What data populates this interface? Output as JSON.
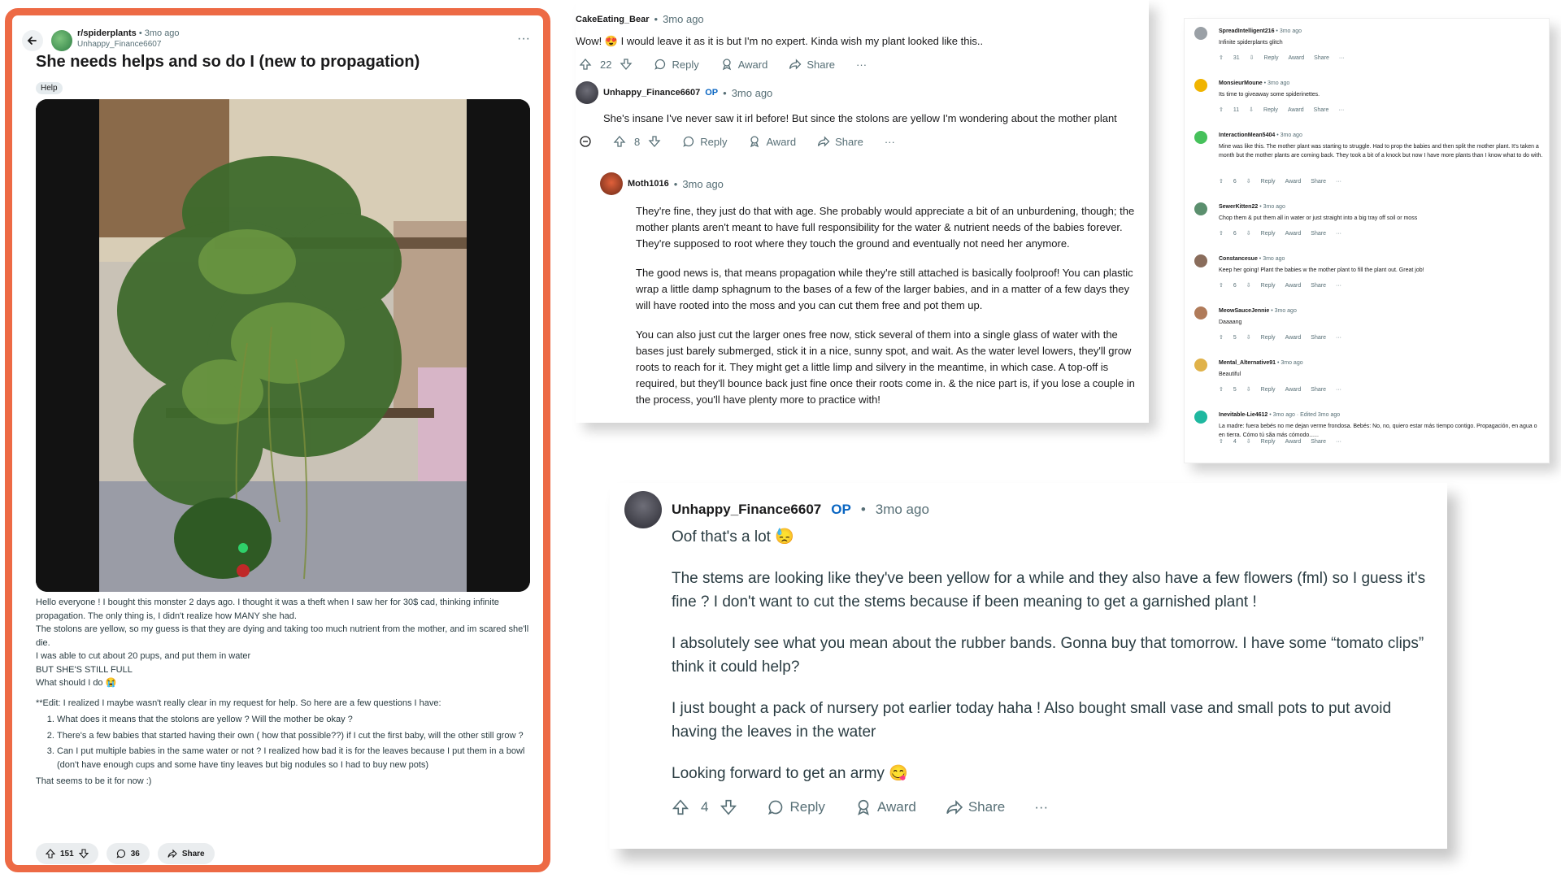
{
  "post": {
    "subreddit": "r/spiderplants",
    "time": "3mo ago",
    "author": "Unhappy_Finance6607",
    "title": "She needs helps and so do I (new to propagation)",
    "flair": "Help",
    "body": [
      "Hello everyone ! I bought this monster 2 days ago. I thought it was a theft when I saw her for 30$ cad, thinking infinite propagation. The only thing is, I didn't realize how MANY she had.",
      "The stolons are yellow, so my guess is that they are dying and taking too much nutrient from the mother, and im scared she'll die.",
      "I was able to cut about 20 pups, and put them in water",
      "BUT SHE'S STILL FULL",
      "What should I do 😭"
    ],
    "edit_intro": "**Edit: I realized I maybe wasn't really clear in my request for help. So here are a few questions I have:",
    "questions": [
      "What does it means that the stolons are yellow ? Will the mother be okay ?",
      "There's a few babies that started having their own ( how that possible??) if I cut the first baby, will the other still grow ?",
      "Can I put multiple babies in the same water or not ? I realized how bad it is for the leaves because I put them in a bowl (don't have enough cups and some have tiny leaves but big nodules so I had to buy new pots)"
    ],
    "outro": "That seems to be it for now :)",
    "votes": "151",
    "comments": "36",
    "share": "Share",
    "more": "···"
  },
  "panel_a": {
    "c1": {
      "user": "CakeEating_Bear",
      "time": "3mo ago",
      "text": "Wow! 😍 I would leave it as it is but I'm no expert. Kinda wish my plant looked like this..",
      "votes": "22"
    },
    "c2": {
      "user": "Unhappy_Finance6607",
      "op": "OP",
      "time": "3mo ago",
      "text": "She's insane I've never saw it irl before! But since the stolons are yellow I'm wondering about the mother plant",
      "votes": "8"
    },
    "c3": {
      "user": "Moth1016",
      "time": "3mo ago",
      "p1": "They're fine, they just do that with age. She probably would appreciate a bit of an unburdening, though; the mother plants aren't meant to have full responsibility for the water & nutrient needs of the babies forever. They're supposed to root where they touch the ground and eventually not need her anymore.",
      "p2": "The good news is, that means propagation while they're still attached is basically foolproof! You can plastic wrap a little damp sphagnum to the bases of a few of the larger babies, and in a matter of a few days they will have rooted into the moss and you can cut them free and pot them up.",
      "p3": "You can also just cut the larger ones free now, stick several of them into a single glass of water with the bases just barely submerged, stick it in a nice, sunny spot, and wait. As the water level lowers, they'll grow roots to reach for it. They might get a little limp and silvery in the meantime, in which case. A top-off is required, but they'll bounce back just fine once their roots come in. & the nice part is, if you lose a couple in the process, you'll have plenty more to practice with!"
    },
    "labels": {
      "reply": "Reply",
      "award": "Award",
      "share": "Share",
      "more": "···"
    }
  },
  "panel_b": {
    "comments": [
      {
        "user": "SpreadIntelligent216",
        "time": "3mo ago",
        "text": "Infinite spiderplants glitch",
        "votes": "31",
        "color": "#9aa0a6"
      },
      {
        "user": "MonsieurMoune",
        "time": "3mo ago",
        "text": "Its time to giveaway some spiderinettes.",
        "votes": "11",
        "color": "#f0b400"
      },
      {
        "user": "InteractionMean5404",
        "time": "3mo ago",
        "text": "Mine was like this. The mother plant was starting to struggle. Had to prop the babies and then split the mother plant. It's taken a month but the mother plants are coming back. They took a bit of a knock but now I have more plants than I know what to do with.",
        "votes": "6",
        "color": "#46c15b"
      },
      {
        "user": "SewerKitten22",
        "time": "3mo ago",
        "text": "Chop them & put them all in water or just straight into a big tray off soil or moss",
        "votes": "6",
        "color": "#5b8f6e"
      },
      {
        "user": "Constancesue",
        "time": "3mo ago",
        "text": "Keep her going! Plant the babies w the mother plant to fill the plant out. Great job!",
        "votes": "6",
        "color": "#8a6d5c"
      },
      {
        "user": "MeowSauceJennie",
        "time": "3mo ago",
        "text": "Daaaang",
        "votes": "5",
        "color": "#b07b5a"
      },
      {
        "user": "Mental_Alternative91",
        "time": "3mo ago",
        "text": "Beautiful",
        "votes": "5",
        "color": "#e0b24a"
      },
      {
        "user": "Inevitable-Lie4612",
        "time": "3mo ago · Edited 3mo ago",
        "text": "La madre: fuera bebés no me dejan verme frondosa. Bebés: No, no, quiero estar más tiempo contigo. Propagación, en agua o en tierra. Cómo tú sãa más cómodo......",
        "votes": "4",
        "color": "#1fb8a0"
      }
    ],
    "labels": {
      "reply": "Reply",
      "award": "Award",
      "share": "Share",
      "more": "···"
    }
  },
  "panel_c": {
    "user": "Unhappy_Finance6607",
    "op": "OP",
    "time": "3mo ago",
    "paragraphs": [
      "Oof that's a lot 😓",
      "The stems are looking like they've been yellow for a while and they also have a few flowers (fml) so I guess it's fine ? I don't want to cut the stems because if been meaning to get a garnished plant !",
      "I absolutely see what you mean about the rubber bands. Gonna buy that tomorrow. I have some “tomato clips” think it could help?",
      "I just bought a pack of nursery pot earlier today haha ! Also bought small vase and small pots to put avoid having the leaves in the water",
      "Looking forward to get an army 😋"
    ],
    "votes": "4",
    "labels": {
      "reply": "Reply",
      "award": "Award",
      "share": "Share",
      "more": "···"
    }
  },
  "colors": {
    "highlight_border": "#ed6a45",
    "op": "#0a66c2",
    "muted": "#576f76"
  },
  "icons": [
    "back-arrow-icon",
    "upvote-icon",
    "downvote-icon",
    "comment-icon",
    "award-icon",
    "share-icon",
    "more-icon",
    "collapse-icon"
  ]
}
